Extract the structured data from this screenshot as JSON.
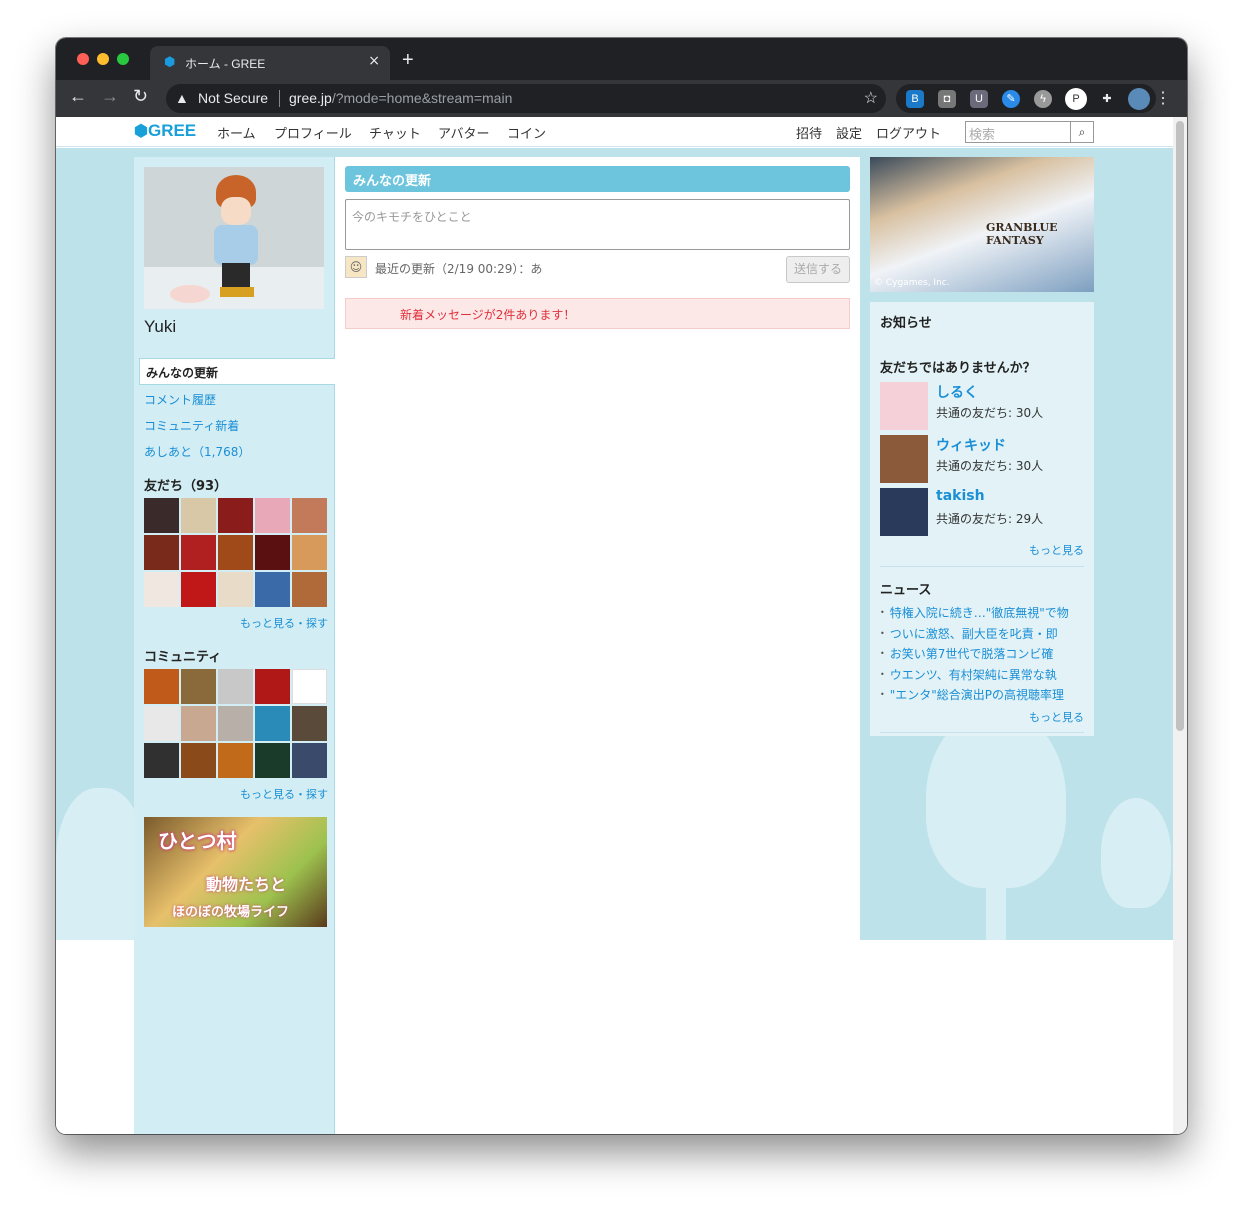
{
  "browser": {
    "tab_title": "ホーム - GREE",
    "close_glyph": "×",
    "new_tab_glyph": "+",
    "security_label": "Not Secure",
    "url_host": "gree.jp",
    "url_rest": "/?mode=home&stream=main",
    "icons": [
      "back-icon",
      "forward-icon",
      "reload-icon",
      "warning-icon",
      "star-icon",
      "extensions-icon",
      "menu-icon"
    ]
  },
  "gnav": {
    "logo": "GREE",
    "items": [
      "ホーム",
      "プロフィール",
      "チャット",
      "アバター",
      "コイン"
    ],
    "right_items": [
      "招待",
      "設定",
      "ログアウト"
    ],
    "search_placeholder": "検索"
  },
  "left": {
    "user_name": "Yuki",
    "active_tab": "みんなの更新",
    "links": [
      "コメント履歴",
      "コミュニティ新着",
      "あしあと（1,768）"
    ],
    "friends_title": "友だち（93）",
    "friends_more": "もっと見る・探す",
    "community_title": "コミュニティ",
    "community_more": "もっと見る・探す",
    "banner_line1": "ひとつ村",
    "banner_line2": "動物たちと",
    "banner_line3": "ほのぼの牧場ライフ",
    "friend_thumb_colors": [
      "#3b2a2a",
      "#d9c8a8",
      "#8a1c1c",
      "#e8a8b8",
      "#c27a5a",
      "#7a2a1a",
      "#b02020",
      "#a04a1a",
      "#5a1010",
      "#d89a5a",
      "#f0e8e0",
      "#c01818",
      "#e8dcc8",
      "#3a6aa8",
      "#b06a3a"
    ],
    "community_thumb_colors": [
      "#c05a1a",
      "#8a6a3a",
      "#c8c8c8",
      "#b01818",
      "#ffffff",
      "#e8e8e8",
      "#c8a890",
      "#b8b0a8",
      "#2a8ab8",
      "#5a4a3a",
      "#303030",
      "#8a4a1a",
      "#c06a1a",
      "#1a3a2a",
      "#3a4a6a"
    ]
  },
  "center": {
    "header": "みんなの更新",
    "status_placeholder": "今のキモチをひとこと",
    "recent_update": "最近の更新（2/19 00:29）：あ",
    "send_button": "送信する",
    "notice": "新着メッセージが2件あります！"
  },
  "right": {
    "banner_title": "GRANBLUE FANTASY",
    "banner_copyright": "© Cygames, Inc.",
    "news_title": "お知らせ",
    "suggest_title": "友だちではありませんか？",
    "suggestions": [
      {
        "name": "しるく",
        "mutual": "共通の友だち: 30人",
        "color": "#f5d0d8"
      },
      {
        "name": "ウィキッド",
        "mutual": "共通の友だち: 30人",
        "color": "#8a5a3a"
      },
      {
        "name": "takish",
        "mutual": "共通の友だち: 29人",
        "color": "#2a3a5a"
      }
    ],
    "suggest_more": "もっと見る",
    "headlines_title": "ニュース",
    "headlines": [
      "特権入院に続き…\"徹底無視\"で物",
      "ついに激怒、副大臣を叱責・即",
      "お笑い第7世代で脱落コンビ確",
      "ウエンツ、有村架純に異常な執",
      "\"エンタ\"総合演出Pの高視聴率理"
    ],
    "headlines_more": "もっと見る"
  },
  "colors": {
    "accent": "#1a8fd6",
    "header_blue": "#6cc4dd",
    "page_bg": "#bde2ea",
    "notice_red": "#e0303a"
  }
}
